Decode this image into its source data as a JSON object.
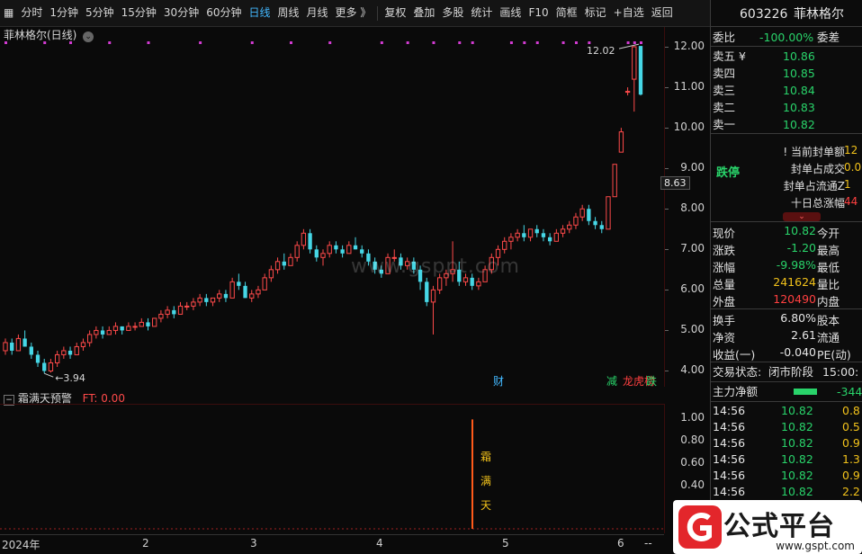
{
  "toolbar": {
    "items": [
      {
        "label": "分时"
      },
      {
        "label": "1分钟"
      },
      {
        "label": "5分钟"
      },
      {
        "label": "15分钟"
      },
      {
        "label": "30分钟"
      },
      {
        "label": "60分钟"
      },
      {
        "label": "日线",
        "active": true
      },
      {
        "label": "周线"
      },
      {
        "label": "月线"
      },
      {
        "label": "更多 》"
      },
      {
        "label": "复权"
      },
      {
        "label": "叠加"
      },
      {
        "label": "多股"
      },
      {
        "label": "统计"
      },
      {
        "label": "画线"
      },
      {
        "label": "F10"
      },
      {
        "label": "简框"
      },
      {
        "label": "标记"
      },
      {
        "label": "+自选"
      },
      {
        "label": "返回"
      }
    ],
    "menu_icon": "grid-menu-icon",
    "code": "603226",
    "name": "菲林格尔"
  },
  "chart": {
    "title": "菲林格尔(日线)",
    "high_label": "12.02",
    "low_label": "3.94",
    "current_price": "8.63",
    "watermark": "www.gsppt.com",
    "event_marks": [
      {
        "label": "财",
        "color": "#43b8ff"
      },
      {
        "label": "减",
        "color": "#29d36a"
      },
      {
        "label": "龙虎榜",
        "color": "#ff4040"
      },
      {
        "label": "跌",
        "color": "#29d36a"
      }
    ],
    "y_ticks": [
      "12.00",
      "11.00",
      "10.00",
      "9.00",
      "8.00",
      "7.00",
      "6.00",
      "5.00",
      "4.00"
    ],
    "x_ticks": [
      "2024年",
      "2",
      "3",
      "4",
      "5",
      "6",
      "--"
    ]
  },
  "indicator": {
    "name": "霜满天预警",
    "ft_label": "FT: 0.00",
    "signal_chars": [
      "霜",
      "满",
      "天"
    ],
    "y_ticks": [
      "1.00",
      "0.80",
      "0.60",
      "0.40",
      "0.20"
    ]
  },
  "panel": {
    "weibi_label": "委比",
    "weibi_value": "-100.00%",
    "weicha_label": "委差",
    "asks": [
      {
        "label": "卖五 ¥",
        "price": "10.86"
      },
      {
        "label": "卖四",
        "price": "10.85"
      },
      {
        "label": "卖三",
        "price": "10.84"
      },
      {
        "label": "卖二",
        "price": "10.83"
      },
      {
        "label": "卖一",
        "price": "10.82"
      }
    ],
    "limit_label": "跌停",
    "limit_rows": [
      {
        "label": "当前封单额",
        "value": "12"
      },
      {
        "label": "封单占成交",
        "value": "0.0"
      },
      {
        "label": "封单占流通Z",
        "value": "1"
      },
      {
        "label": "十日总涨幅",
        "value": "44"
      }
    ],
    "stats": [
      {
        "l": "现价",
        "v": "10.82",
        "c": "grn",
        "r": "今开"
      },
      {
        "l": "涨跌",
        "v": "-1.20",
        "c": "grn",
        "r": "最高"
      },
      {
        "l": "涨幅",
        "v": "-9.98%",
        "c": "grn",
        "r": "最低"
      },
      {
        "l": "总量",
        "v": "241624",
        "c": "yel",
        "r": "量比"
      },
      {
        "l": "外盘",
        "v": "120490",
        "c": "red",
        "r": "内盘"
      }
    ],
    "stats2": [
      {
        "l": "换手",
        "v": "6.80%",
        "r": "股本"
      },
      {
        "l": "净资",
        "v": "2.61",
        "r": "流通"
      },
      {
        "l": "收益(一)",
        "v": "-0.040",
        "r": "PE(动)"
      }
    ],
    "trade_state_label": "交易状态:",
    "trade_state": "闭市阶段",
    "trade_time": "15:00:",
    "main_flow_label": "主力净额",
    "main_flow_value": "-344",
    "ticks": [
      {
        "t": "14:56",
        "p": "10.82",
        "v": "0.8"
      },
      {
        "t": "14:56",
        "p": "10.82",
        "v": "0.5"
      },
      {
        "t": "14:56",
        "p": "10.82",
        "v": "0.9"
      },
      {
        "t": "14:56",
        "p": "10.82",
        "v": "1.3"
      },
      {
        "t": "14:56",
        "p": "10.82",
        "v": "0.9"
      },
      {
        "t": "14:56",
        "p": "10.82",
        "v": "2.2"
      }
    ]
  },
  "logo": {
    "text": "公式平台",
    "url": "www.gspt.com"
  },
  "chart_data": {
    "type": "candlestick",
    "title": "菲林格尔(日线)",
    "ylim": [
      3.7,
      12.4
    ],
    "candles": [
      [
        4.5,
        4.8,
        4.4,
        4.7
      ],
      [
        4.7,
        4.8,
        4.4,
        4.5
      ],
      [
        4.5,
        4.9,
        4.5,
        4.8
      ],
      [
        4.8,
        5.0,
        4.6,
        4.6
      ],
      [
        4.6,
        4.7,
        4.3,
        4.4
      ],
      [
        4.4,
        4.5,
        4.1,
        4.2
      ],
      [
        4.2,
        4.3,
        3.94,
        4.0
      ],
      [
        4.0,
        4.3,
        3.96,
        4.2
      ],
      [
        4.2,
        4.5,
        4.1,
        4.4
      ],
      [
        4.4,
        4.6,
        4.3,
        4.5
      ],
      [
        4.5,
        4.6,
        4.3,
        4.4
      ],
      [
        4.4,
        4.7,
        4.4,
        4.6
      ],
      [
        4.6,
        4.8,
        4.5,
        4.7
      ],
      [
        4.7,
        5.0,
        4.6,
        4.9
      ],
      [
        4.9,
        5.1,
        4.8,
        5.0
      ],
      [
        5.0,
        5.1,
        4.8,
        4.9
      ],
      [
        4.9,
        5.1,
        4.9,
        5.0
      ],
      [
        5.0,
        5.2,
        4.9,
        5.1
      ],
      [
        5.1,
        5.1,
        4.9,
        5.0
      ],
      [
        5.0,
        5.2,
        5.0,
        5.1
      ],
      [
        5.1,
        5.2,
        5.0,
        5.1
      ],
      [
        5.1,
        5.3,
        5.1,
        5.2
      ],
      [
        5.2,
        5.3,
        5.0,
        5.1
      ],
      [
        5.1,
        5.3,
        5.1,
        5.3
      ],
      [
        5.3,
        5.5,
        5.2,
        5.4
      ],
      [
        5.4,
        5.6,
        5.3,
        5.5
      ],
      [
        5.5,
        5.6,
        5.3,
        5.4
      ],
      [
        5.4,
        5.7,
        5.4,
        5.6
      ],
      [
        5.6,
        5.7,
        5.5,
        5.6
      ],
      [
        5.6,
        5.8,
        5.5,
        5.7
      ],
      [
        5.7,
        5.9,
        5.6,
        5.8
      ],
      [
        5.8,
        5.9,
        5.6,
        5.7
      ],
      [
        5.7,
        5.8,
        5.6,
        5.8
      ],
      [
        5.8,
        6.0,
        5.7,
        5.9
      ],
      [
        5.9,
        6.0,
        5.7,
        5.8
      ],
      [
        5.8,
        6.3,
        5.8,
        6.2
      ],
      [
        6.2,
        6.4,
        6.0,
        6.1
      ],
      [
        6.1,
        6.2,
        5.8,
        5.8
      ],
      [
        5.8,
        6.0,
        5.7,
        5.9
      ],
      [
        5.9,
        6.1,
        5.8,
        6.0
      ],
      [
        6.0,
        6.4,
        6.0,
        6.3
      ],
      [
        6.3,
        6.6,
        6.2,
        6.5
      ],
      [
        6.5,
        6.8,
        6.4,
        6.7
      ],
      [
        6.7,
        6.9,
        6.5,
        6.6
      ],
      [
        6.6,
        6.9,
        6.6,
        6.8
      ],
      [
        6.8,
        7.2,
        6.7,
        7.1
      ],
      [
        7.1,
        7.5,
        7.0,
        7.4
      ],
      [
        7.4,
        7.5,
        6.9,
        7.0
      ],
      [
        7.0,
        7.1,
        6.7,
        6.8
      ],
      [
        6.8,
        7.0,
        6.6,
        6.9
      ],
      [
        6.9,
        7.2,
        6.8,
        7.1
      ],
      [
        7.1,
        7.2,
        6.9,
        7.0
      ],
      [
        7.0,
        7.1,
        6.8,
        6.9
      ],
      [
        6.9,
        7.2,
        6.9,
        7.1
      ],
      [
        7.1,
        7.3,
        7.0,
        7.0
      ],
      [
        7.0,
        7.1,
        6.8,
        6.9
      ],
      [
        6.9,
        7.0,
        6.6,
        6.7
      ],
      [
        6.7,
        6.8,
        6.4,
        6.5
      ],
      [
        6.5,
        6.6,
        6.3,
        6.4
      ],
      [
        6.4,
        6.9,
        6.4,
        6.8
      ],
      [
        6.8,
        7.0,
        6.7,
        6.8
      ],
      [
        6.8,
        6.9,
        6.5,
        6.6
      ],
      [
        6.6,
        6.8,
        6.5,
        6.7
      ],
      [
        6.7,
        6.8,
        6.4,
        6.5
      ],
      [
        6.5,
        6.6,
        6.0,
        6.2
      ],
      [
        6.2,
        6.3,
        5.6,
        5.7
      ],
      [
        5.7,
        6.1,
        4.9,
        6.0
      ],
      [
        6.0,
        6.4,
        5.9,
        6.3
      ],
      [
        6.3,
        6.5,
        6.1,
        6.4
      ],
      [
        6.4,
        7.2,
        6.2,
        6.5
      ],
      [
        6.5,
        6.7,
        6.1,
        6.2
      ],
      [
        6.2,
        6.4,
        6.1,
        6.3
      ],
      [
        6.3,
        6.4,
        6.0,
        6.1
      ],
      [
        6.1,
        6.3,
        6.0,
        6.2
      ],
      [
        6.2,
        6.6,
        6.2,
        6.5
      ],
      [
        6.5,
        6.9,
        6.4,
        6.8
      ],
      [
        6.8,
        7.1,
        6.6,
        7.0
      ],
      [
        7.0,
        7.3,
        6.9,
        7.2
      ],
      [
        7.2,
        7.4,
        7.0,
        7.3
      ],
      [
        7.3,
        7.5,
        7.2,
        7.4
      ],
      [
        7.4,
        7.6,
        7.2,
        7.3
      ],
      [
        7.3,
        7.5,
        7.2,
        7.5
      ],
      [
        7.5,
        7.6,
        7.3,
        7.4
      ],
      [
        7.4,
        7.5,
        7.2,
        7.3
      ],
      [
        7.3,
        7.4,
        7.1,
        7.2
      ],
      [
        7.2,
        7.5,
        7.2,
        7.4
      ],
      [
        7.4,
        7.6,
        7.3,
        7.5
      ],
      [
        7.5,
        7.7,
        7.4,
        7.6
      ],
      [
        7.6,
        7.9,
        7.5,
        7.8
      ],
      [
        7.8,
        8.1,
        7.7,
        8.0
      ],
      [
        8.0,
        8.1,
        7.6,
        7.7
      ],
      [
        7.7,
        7.8,
        7.5,
        7.6
      ],
      [
        7.6,
        7.7,
        7.4,
        7.5
      ],
      [
        7.5,
        8.3,
        7.5,
        8.3
      ],
      [
        8.3,
        9.1,
        8.3,
        9.1
      ],
      [
        9.4,
        10.0,
        9.4,
        9.9
      ],
      [
        10.9,
        11.0,
        10.8,
        10.9
      ],
      [
        11.2,
        12.02,
        10.4,
        12.0
      ],
      [
        12.02,
        12.02,
        10.8,
        10.82
      ]
    ],
    "indicator_bars": [
      {
        "index": 72,
        "value": 1.0
      }
    ],
    "indicator_ylim": [
      0,
      1.1
    ]
  }
}
